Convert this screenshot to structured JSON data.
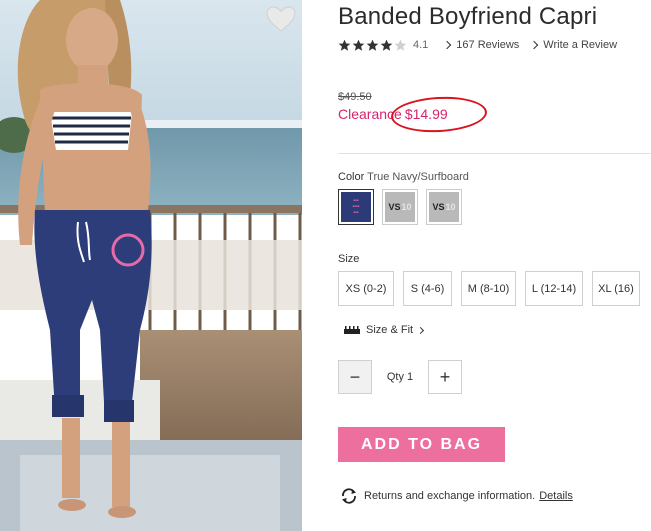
{
  "product": {
    "title": "Banded Boyfriend Capri",
    "rating": "4.1",
    "stars_filled": 4,
    "stars_total": 5,
    "reviews_label": "167 Reviews",
    "write_review_label": "Write a Review"
  },
  "pricing": {
    "original_price": "$49.50",
    "clearance_label": "Clearance",
    "sale_price": "$14.99",
    "sale_color": "#d6246e"
  },
  "color": {
    "label": "Color",
    "selected": "True Navy/Surfboard",
    "swatches": [
      {
        "name": "True Navy/Surfboard",
        "selected": true
      },
      {
        "text": "VS",
        "num": "10"
      },
      {
        "text": "VS",
        "num": "10"
      }
    ]
  },
  "size": {
    "label": "Size",
    "options": [
      "XS (0-2)",
      "S (4-6)",
      "M (8-10)",
      "L (12-14)",
      "XL (16)"
    ],
    "size_fit_label": "Size & Fit"
  },
  "quantity": {
    "minus": "−",
    "label": "Qty 1",
    "plus": "+"
  },
  "add_to_bag": {
    "label": "ADD TO BAG",
    "color": "#ec6f9e"
  },
  "returns": {
    "text": "Returns and exchange information.",
    "details_label": "Details"
  },
  "icons": {
    "favorite": "heart-icon",
    "returns": "refresh-icon",
    "size_fit": "ruler-icon"
  },
  "annotation_color": "#d8141d"
}
